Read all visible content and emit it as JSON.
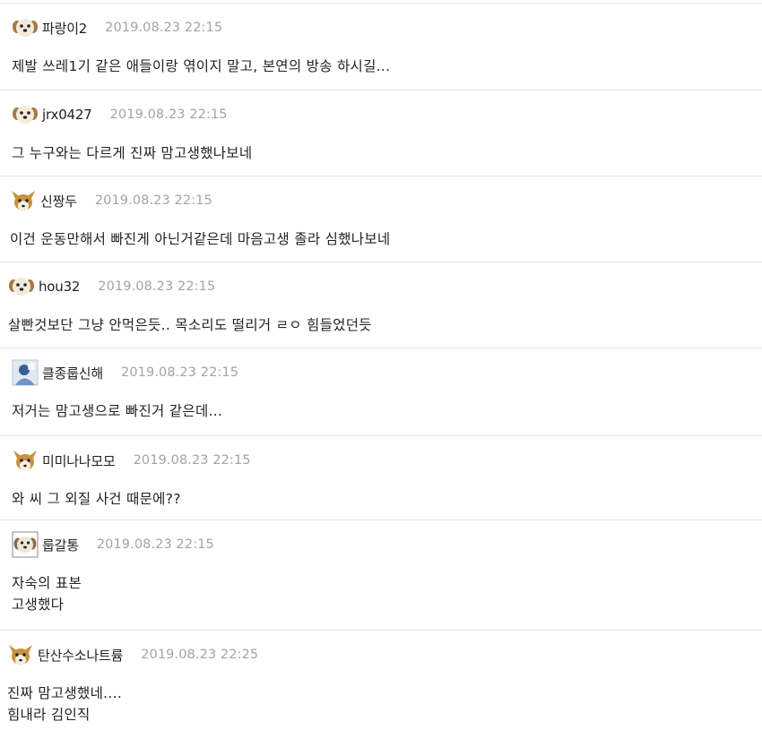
{
  "comments": [
    {
      "nickname": "파랑이2",
      "timestamp": "2019.08.23 22:15",
      "avatar": "puppy-avatar",
      "lines": [
        "제발 쓰레1기 같은 애들이랑 엮이지 말고, 본연의 방송 하시길..."
      ]
    },
    {
      "nickname": "jrx0427",
      "timestamp": "2019.08.23 22:15",
      "avatar": "puppy-avatar",
      "lines": [
        "그 누구와는 다르게 진짜 맘고생했나보네"
      ]
    },
    {
      "nickname": "신짱두",
      "timestamp": "2019.08.23 22:15",
      "avatar": "fox-avatar",
      "lines": [
        "이건 운동만해서 빠진게 아닌거같은데 마음고생 졸라 심했나보네"
      ]
    },
    {
      "nickname": "hou32",
      "timestamp": "2019.08.23 22:15",
      "avatar": "puppy-avatar",
      "lines": [
        "살빤것보단 그냥 안먹은듯.. 목소리도 떨리거 ㄹㅇ 힘들었던듯"
      ]
    },
    {
      "nickname": "클종룹신해",
      "timestamp": "2019.08.23 22:15",
      "avatar": "photo-avatar",
      "lines": [
        "저거는 맘고생으로 빠진거 같은데..."
      ]
    },
    {
      "nickname": "미미나나모모",
      "timestamp": "2019.08.23 22:15",
      "avatar": "fox-avatar",
      "lines": [
        "와 씨 그 외질 사건 때문에??"
      ]
    },
    {
      "nickname": "룹갈통",
      "timestamp": "2019.08.23 22:15",
      "avatar": "puppy-framed-avatar",
      "lines": [
        "자숙의 표본",
        "고생했다"
      ]
    },
    {
      "nickname": "탄산수소나트륨",
      "timestamp": "2019.08.23 22:25",
      "avatar": "fox-avatar",
      "lines": [
        "진짜 맘고생했네....",
        "힘내라 김인직"
      ]
    }
  ],
  "colors": {
    "timestamp": "#a3a3a3",
    "divider": "#e4e4e4",
    "text": "#222222"
  }
}
